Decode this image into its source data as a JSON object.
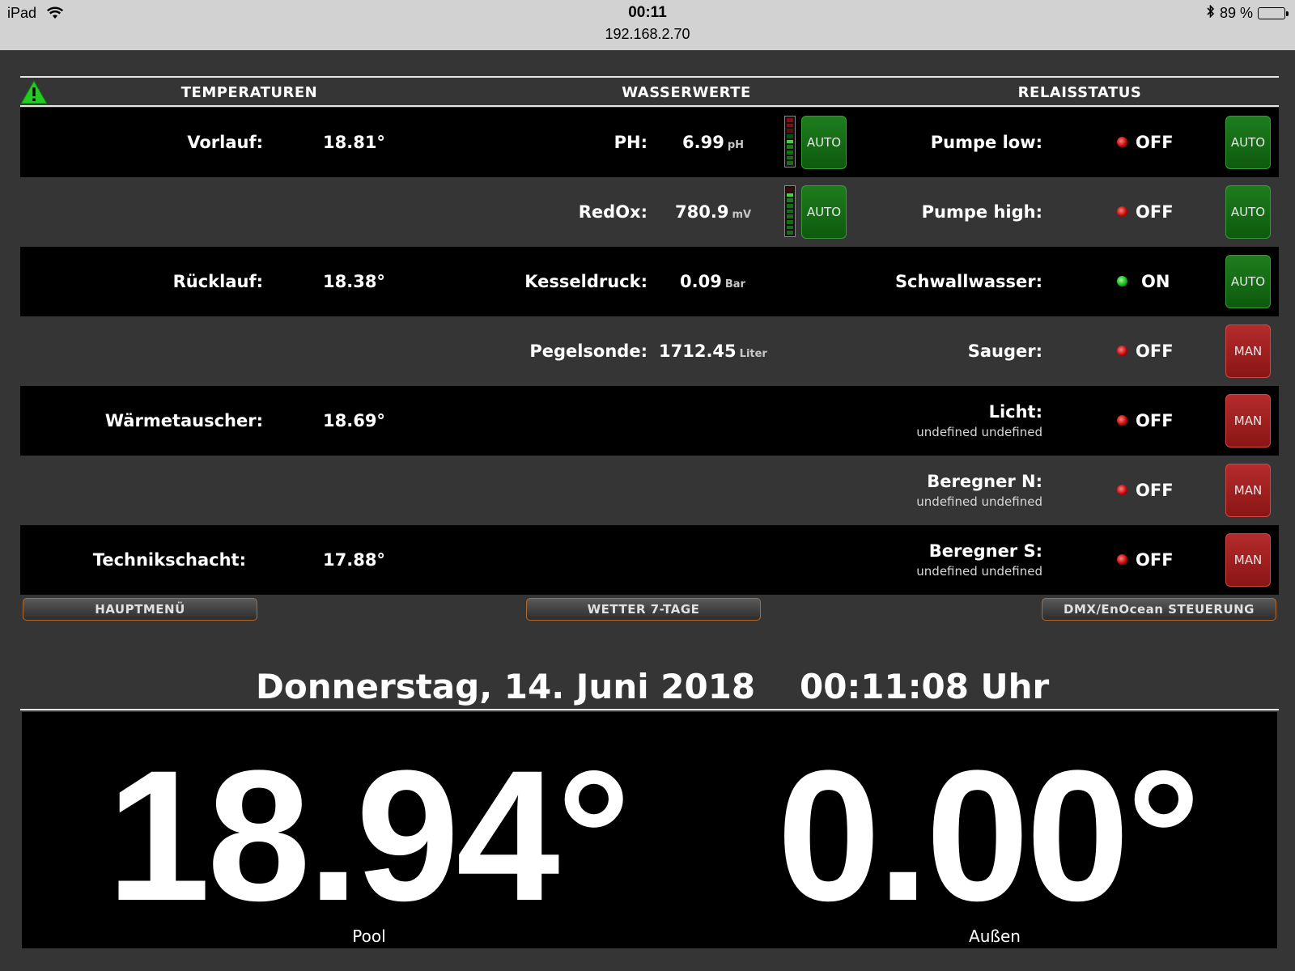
{
  "status_bar": {
    "device": "iPad",
    "time": "00:11",
    "url": "192.168.2.70",
    "battery": "89 %"
  },
  "header": {
    "temperaturen": "TEMPERATUREN",
    "wasserwerte": "WASSERWERTE",
    "relaisstatus": "RELAISSTATUS"
  },
  "temps": [
    {
      "label": "Vorlauf:",
      "value": "18.81°"
    },
    {
      "label": "Rücklauf:",
      "value": "18.38°"
    },
    {
      "label": "Wärmetauscher:",
      "value": "18.69°"
    },
    {
      "label": "Technikschacht:",
      "value": "17.88°"
    }
  ],
  "water": [
    {
      "label": "PH:",
      "value": "6.99",
      "unit": "pH",
      "button": "AUTO"
    },
    {
      "label": "RedOx:",
      "value": "780.9",
      "unit": "mV",
      "button": "AUTO"
    },
    {
      "label": "Kesseldruck:",
      "value": "0.09",
      "unit": "Bar"
    },
    {
      "label": "Pegelsonde:",
      "value": "1712.45",
      "unit": "Liter"
    }
  ],
  "relays": [
    {
      "label": "Pumpe low:",
      "state": "OFF",
      "led": "red",
      "mode": "AUTO",
      "sub": ""
    },
    {
      "label": "Pumpe high:",
      "state": "OFF",
      "led": "red",
      "mode": "AUTO",
      "sub": ""
    },
    {
      "label": "Schwallwasser:",
      "state": "ON",
      "led": "green",
      "mode": "AUTO",
      "sub": ""
    },
    {
      "label": "Sauger:",
      "state": "OFF",
      "led": "red",
      "mode": "MAN",
      "sub": ""
    },
    {
      "label": "Licht:",
      "state": "OFF",
      "led": "red",
      "mode": "MAN",
      "sub": "undefined undefined"
    },
    {
      "label": "Beregner N:",
      "state": "OFF",
      "led": "red",
      "mode": "MAN",
      "sub": "undefined undefined"
    },
    {
      "label": "Beregner S:",
      "state": "OFF",
      "led": "red",
      "mode": "MAN",
      "sub": "undefined undefined"
    }
  ],
  "nav": {
    "main_menu": "HAUPTMENÜ",
    "weather": "WETTER 7-TAGE",
    "dmx": "DMX/EnOcean STEUERUNG"
  },
  "date_line": {
    "date": "Donnerstag, 14. Juni 2018",
    "time": "00:11:08 Uhr"
  },
  "big": {
    "pool_value": "18.94°",
    "pool_label": "Pool",
    "outside_value": "0.00°",
    "outside_label": "Außen"
  },
  "colors": {
    "background": "#353535",
    "auto_green": "#1d7d1d",
    "man_red": "#b52b2b",
    "warning": "#22cc22"
  }
}
